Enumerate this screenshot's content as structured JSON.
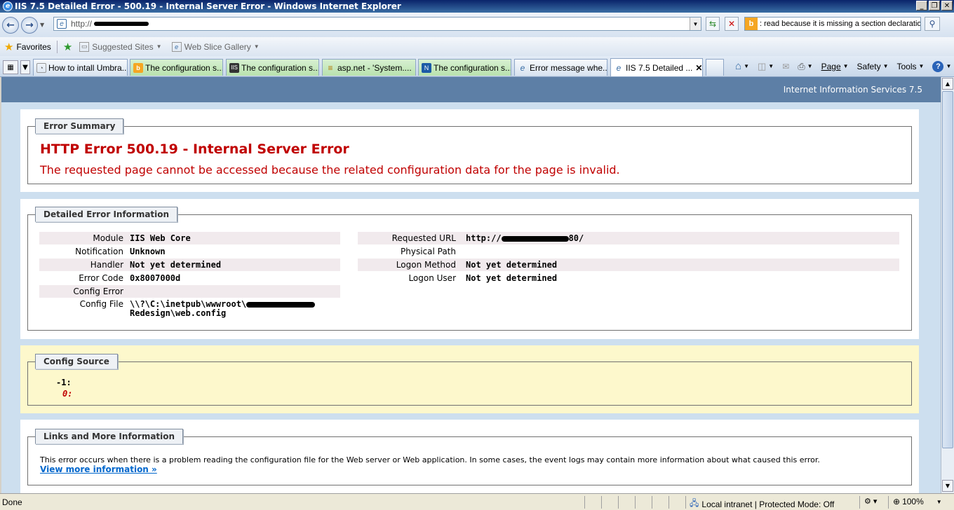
{
  "window": {
    "title": "IIS 7.5 Detailed Error - 500.19 - Internal Server Error - Windows Internet Explorer"
  },
  "address": {
    "url_prefix": "http://",
    "search_text": ": read because it is missing a section declaration"
  },
  "favorites": {
    "label": "Favorites",
    "items": [
      {
        "label": "Suggested Sites"
      },
      {
        "label": "Web Slice Gallery"
      }
    ]
  },
  "tabs": [
    {
      "label": "How to intall Umbra..."
    },
    {
      "label": "The configuration s..."
    },
    {
      "label": "The configuration s..."
    },
    {
      "label": "asp.net - 'System...."
    },
    {
      "label": "The configuration s..."
    },
    {
      "label": "Error message whe..."
    },
    {
      "label": "IIS 7.5 Detailed ..."
    }
  ],
  "commands": {
    "page": "Page",
    "safety": "Safety",
    "tools": "Tools"
  },
  "iis": {
    "header": "Internet Information Services 7.5"
  },
  "summary": {
    "legend": "Error Summary",
    "title": "HTTP Error 500.19 - Internal Server Error",
    "subtitle": "The requested page cannot be accessed because the related configuration data for the page is invalid."
  },
  "details": {
    "legend": "Detailed Error Information",
    "left": [
      {
        "key": "Module",
        "value": "IIS Web Core"
      },
      {
        "key": "Notification",
        "value": "Unknown"
      },
      {
        "key": "Handler",
        "value": "Not yet determined"
      },
      {
        "key": "Error Code",
        "value": "0x8007000d"
      },
      {
        "key": "Config Error",
        "value": ""
      },
      {
        "key": "Config File",
        "value": "\\\\?\\C:\\inetpub\\wwwroot\\",
        "value2": "Redesign\\web.config"
      }
    ],
    "right": [
      {
        "key": "Requested URL",
        "value": "http://",
        "value_suffix": "80/"
      },
      {
        "key": "Physical Path",
        "value": ""
      },
      {
        "key": "Logon Method",
        "value": "Not yet determined"
      },
      {
        "key": "Logon User",
        "value": "Not yet determined"
      }
    ]
  },
  "config_source": {
    "legend": "Config Source",
    "line1": "-1:",
    "line2": "0:"
  },
  "links": {
    "legend": "Links and More Information",
    "text": "This error occurs when there is a problem reading the configuration file for the Web server or Web application. In some cases, the event logs may contain more information about what caused this error.",
    "more": "View more information »"
  },
  "status": {
    "text": "Done",
    "zone": "Local intranet | Protected Mode: Off",
    "zoom": "100%"
  }
}
